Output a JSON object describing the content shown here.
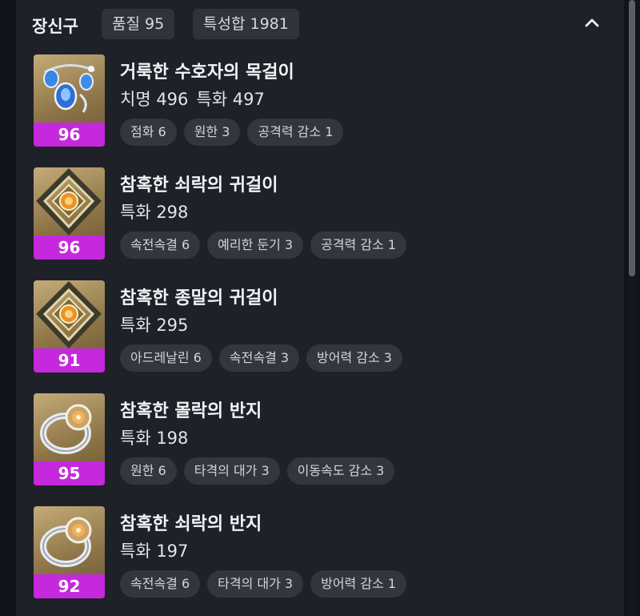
{
  "header": {
    "title": "장신구",
    "quality": "품질 95",
    "stat_total": "특성합 1981",
    "collapse_icon": "chevron-up-icon"
  },
  "items": [
    {
      "name": "거룩한 수호자의 목걸이",
      "level": "96",
      "stats": [
        "치명 496",
        "특화 497"
      ],
      "tags": [
        "점화 6",
        "원한 3",
        "공격력 감소 1"
      ],
      "icon": "necklace-icon"
    },
    {
      "name": "참혹한 쇠락의 귀걸이",
      "level": "96",
      "stats": [
        "특화 298"
      ],
      "tags": [
        "속전속결 6",
        "예리한 둔기 3",
        "공격력 감소 1"
      ],
      "icon": "earring-icon"
    },
    {
      "name": "참혹한 종말의 귀걸이",
      "level": "91",
      "stats": [
        "특화 295"
      ],
      "tags": [
        "아드레날린 6",
        "속전속결 3",
        "방어력 감소 3"
      ],
      "icon": "earring-icon"
    },
    {
      "name": "참혹한 몰락의 반지",
      "level": "95",
      "stats": [
        "특화 198"
      ],
      "tags": [
        "원한 6",
        "타격의 대가 3",
        "이동속도 감소 3"
      ],
      "icon": "ring-icon"
    },
    {
      "name": "참혹한 쇠락의 반지",
      "level": "92",
      "stats": [
        "특화 197"
      ],
      "tags": [
        "속전속결 6",
        "타격의 대가 3",
        "방어력 감소 1"
      ],
      "icon": "ring-icon"
    }
  ],
  "colors": {
    "panel_bg": "#1e2128",
    "level_badge": "#c628de",
    "chip_bg": "#33363e"
  }
}
